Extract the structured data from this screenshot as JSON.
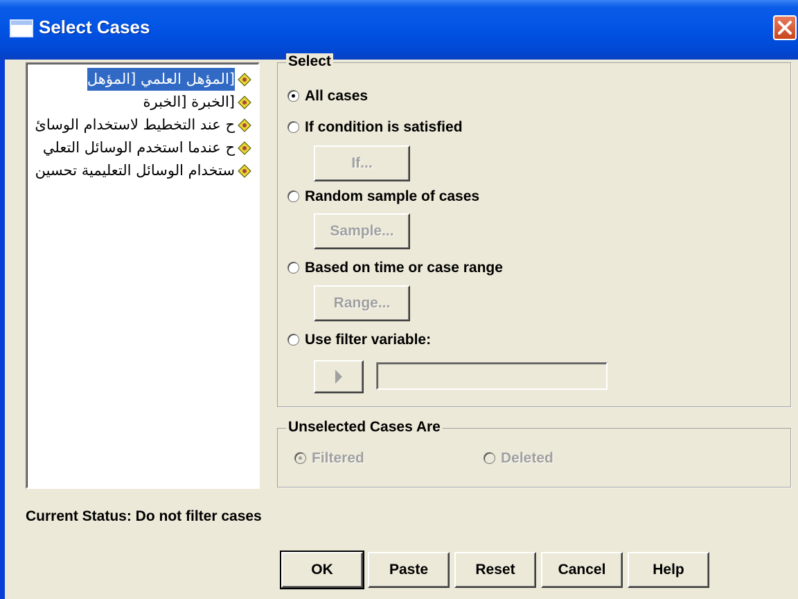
{
  "window": {
    "title": "Select Cases",
    "icon": "window-icon",
    "close_icon": "close-icon"
  },
  "variables": [
    {
      "label": "[المؤهل العلمي [المؤهل",
      "selected": true
    },
    {
      "label": "[الخبرة [الخبرة",
      "selected": false
    },
    {
      "label": "ح عند التخطيط لاستخدام الوسائ",
      "selected": false
    },
    {
      "label": "ح عندما استخدم الوسائل التعلي",
      "selected": false
    },
    {
      "label": "ستخدام الوسائل التعليمية تحسين",
      "selected": false
    }
  ],
  "select_group": {
    "legend": "Select",
    "options": [
      {
        "label": "All cases",
        "mnemonic": "A",
        "checked": true
      },
      {
        "label": "If condition is satisfied",
        "mnemonic": "c",
        "checked": false
      },
      {
        "label": "Random sample of cases",
        "mnemonic": "d",
        "checked": false
      },
      {
        "label": "Based on time or case range",
        "mnemonic": "B",
        "checked": false
      },
      {
        "label": "Use filter variable:",
        "mnemonic": "U",
        "checked": false
      }
    ],
    "if_button": "If...",
    "sample_button": "Sample...",
    "range_button": "Range...",
    "filter_value": ""
  },
  "unselected_group": {
    "legend": "Unselected Cases Are",
    "filtered": "Filtered",
    "deleted": "Deleted",
    "filtered_checked": true
  },
  "status_text": "Current Status: Do not filter cases",
  "buttons": {
    "ok": "OK",
    "paste": "Paste",
    "reset": "Reset",
    "cancel": "Cancel",
    "help": "Help"
  },
  "colors": {
    "title_bar": "#0153e3",
    "selection": "#316ac5",
    "dialog_bg": "#ece9d8"
  }
}
